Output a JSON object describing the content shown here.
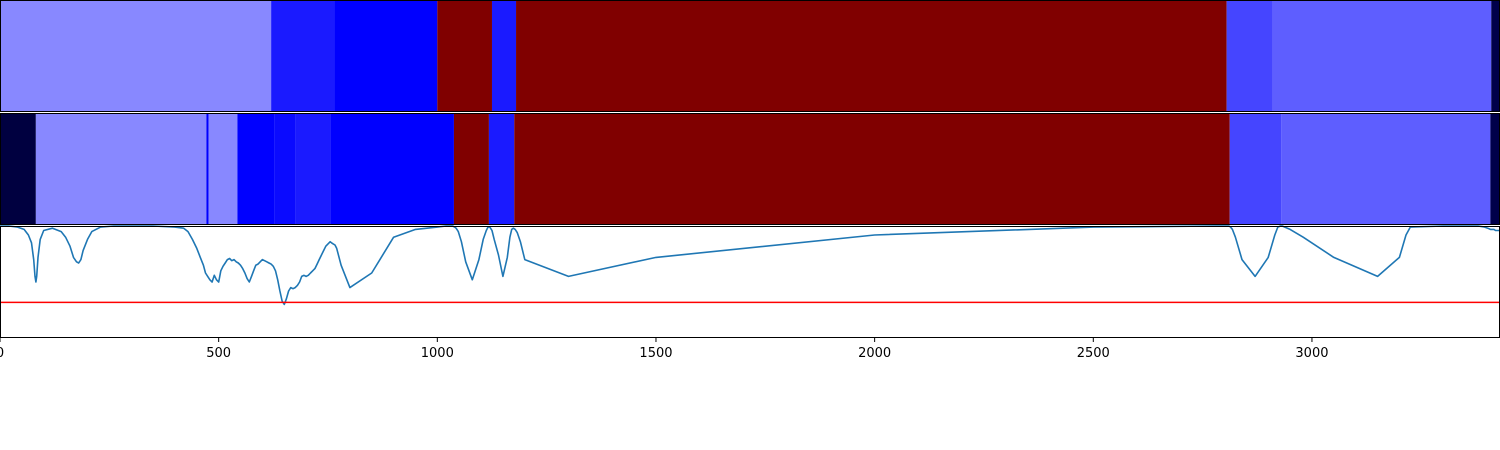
{
  "chart_data": {
    "type": "heatmap",
    "title": "",
    "xlabel": "",
    "ylabel": "",
    "xlim": [
      0,
      3430
    ],
    "grid": false,
    "legend": "none",
    "xticks": [
      0,
      500,
      1000,
      1500,
      2000,
      2500,
      3000
    ],
    "xtick_labels": [
      "0",
      "500",
      "1000",
      "1500",
      "2000",
      "2500",
      "3000"
    ],
    "rows": [
      {
        "segments": [
          {
            "start": 0,
            "end": 620,
            "color": "#8888ff"
          },
          {
            "start": 620,
            "end": 765,
            "color": "#1a1aff"
          },
          {
            "start": 765,
            "end": 1000,
            "color": "#0000ff"
          },
          {
            "start": 1000,
            "end": 1125,
            "color": "#800000"
          },
          {
            "start": 1125,
            "end": 1180,
            "color": "#1a1aff"
          },
          {
            "start": 1180,
            "end": 2805,
            "color": "#800000"
          },
          {
            "start": 2805,
            "end": 2910,
            "color": "#4545ff"
          },
          {
            "start": 2910,
            "end": 3410,
            "color": "#5e5eff"
          },
          {
            "start": 3410,
            "end": 3430,
            "color": "#00004a"
          }
        ]
      },
      {
        "segments": [
          {
            "start": 0,
            "end": 82,
            "color": "#000040"
          },
          {
            "start": 82,
            "end": 472,
            "color": "#8888ff"
          },
          {
            "start": 472,
            "end": 477,
            "color": "#0000ff"
          },
          {
            "start": 477,
            "end": 543,
            "color": "#8888ff"
          },
          {
            "start": 543,
            "end": 628,
            "color": "#0000ff"
          },
          {
            "start": 628,
            "end": 676,
            "color": "#0a0aff"
          },
          {
            "start": 676,
            "end": 755,
            "color": "#1a1aff"
          },
          {
            "start": 755,
            "end": 1038,
            "color": "#0000ff"
          },
          {
            "start": 1038,
            "end": 1118,
            "color": "#800000"
          },
          {
            "start": 1118,
            "end": 1176,
            "color": "#1a1aff"
          },
          {
            "start": 1176,
            "end": 2812,
            "color": "#800000"
          },
          {
            "start": 2812,
            "end": 2930,
            "color": "#4545ff"
          },
          {
            "start": 2930,
            "end": 3408,
            "color": "#5e5eff"
          },
          {
            "start": 3408,
            "end": 3430,
            "color": "#00004a"
          }
        ]
      }
    ],
    "line_series": {
      "color": "#1f77b4",
      "ylim": [
        0,
        1
      ],
      "x": [
        0,
        20,
        40,
        55,
        65,
        72,
        77,
        80,
        82,
        84,
        87,
        92,
        100,
        120,
        140,
        150,
        160,
        168,
        175,
        180,
        185,
        190,
        200,
        210,
        230,
        260,
        300,
        350,
        400,
        420,
        430,
        440,
        450,
        458,
        465,
        470,
        475,
        480,
        485,
        490,
        495,
        500,
        505,
        510,
        515,
        520,
        525,
        530,
        535,
        540,
        545,
        550,
        555,
        560,
        565,
        570,
        575,
        580,
        585,
        590,
        595,
        600,
        605,
        610,
        615,
        620,
        625,
        630,
        635,
        640,
        645,
        650,
        655,
        660,
        665,
        670,
        675,
        680,
        685,
        690,
        695,
        700,
        705,
        710,
        715,
        720,
        725,
        730,
        735,
        740,
        745,
        750,
        755,
        758,
        762,
        766,
        770,
        780,
        800,
        850,
        900,
        950,
        1000,
        1020,
        1030,
        1035,
        1040,
        1043,
        1048,
        1055,
        1065,
        1080,
        1095,
        1105,
        1112,
        1116,
        1120,
        1125,
        1130,
        1140,
        1150,
        1160,
        1166,
        1170,
        1174,
        1178,
        1183,
        1190,
        1200,
        1300,
        1500,
        2000,
        2500,
        2780,
        2795,
        2805,
        2810,
        2814,
        2818,
        2825,
        2840,
        2870,
        2900,
        2915,
        2922,
        2928,
        2932,
        2938,
        2950,
        2980,
        3050,
        3150,
        3200,
        3215,
        3225,
        3300,
        3350,
        3380,
        3395,
        3402,
        3408,
        3412,
        3416,
        3420,
        3430
      ],
      "y": [
        1.0,
        1.0,
        0.99,
        0.97,
        0.92,
        0.85,
        0.7,
        0.55,
        0.5,
        0.55,
        0.72,
        0.88,
        0.96,
        0.98,
        0.95,
        0.9,
        0.82,
        0.72,
        0.68,
        0.67,
        0.7,
        0.78,
        0.88,
        0.95,
        0.99,
        1.0,
        1.0,
        1.0,
        0.99,
        0.98,
        0.95,
        0.88,
        0.8,
        0.72,
        0.65,
        0.58,
        0.55,
        0.52,
        0.5,
        0.56,
        0.52,
        0.5,
        0.6,
        0.64,
        0.67,
        0.7,
        0.71,
        0.69,
        0.7,
        0.68,
        0.67,
        0.65,
        0.62,
        0.58,
        0.53,
        0.5,
        0.55,
        0.6,
        0.65,
        0.66,
        0.68,
        0.7,
        0.69,
        0.68,
        0.67,
        0.66,
        0.64,
        0.6,
        0.52,
        0.42,
        0.33,
        0.3,
        0.35,
        0.42,
        0.45,
        0.44,
        0.45,
        0.47,
        0.5,
        0.55,
        0.56,
        0.55,
        0.56,
        0.58,
        0.6,
        0.62,
        0.66,
        0.7,
        0.74,
        0.78,
        0.82,
        0.84,
        0.86,
        0.85,
        0.84,
        0.83,
        0.8,
        0.65,
        0.45,
        0.58,
        0.9,
        0.97,
        0.99,
        1.0,
        1.0,
        1.0,
        0.99,
        0.98,
        0.95,
        0.86,
        0.68,
        0.52,
        0.7,
        0.88,
        0.96,
        0.99,
        0.99,
        0.96,
        0.88,
        0.74,
        0.55,
        0.72,
        0.9,
        0.97,
        0.98,
        0.97,
        0.94,
        0.86,
        0.7,
        0.55,
        0.72,
        0.92,
        0.99,
        1.0,
        1.0,
        1.0,
        1.0,
        0.99,
        0.97,
        0.9,
        0.7,
        0.55,
        0.72,
        0.92,
        0.99,
        1.0,
        1.0,
        0.99,
        0.97,
        0.9,
        0.72,
        0.55,
        0.72,
        0.92,
        0.99,
        1.0,
        1.0,
        1.0,
        0.99,
        0.98,
        0.97,
        0.97,
        0.97,
        0.96,
        0.96,
        0.95,
        0.94,
        0.85,
        0.68,
        0.53,
        0.68,
        0.88,
        0.98
      ]
    },
    "threshold": {
      "value": 0.318,
      "color": "#ff0000"
    }
  }
}
